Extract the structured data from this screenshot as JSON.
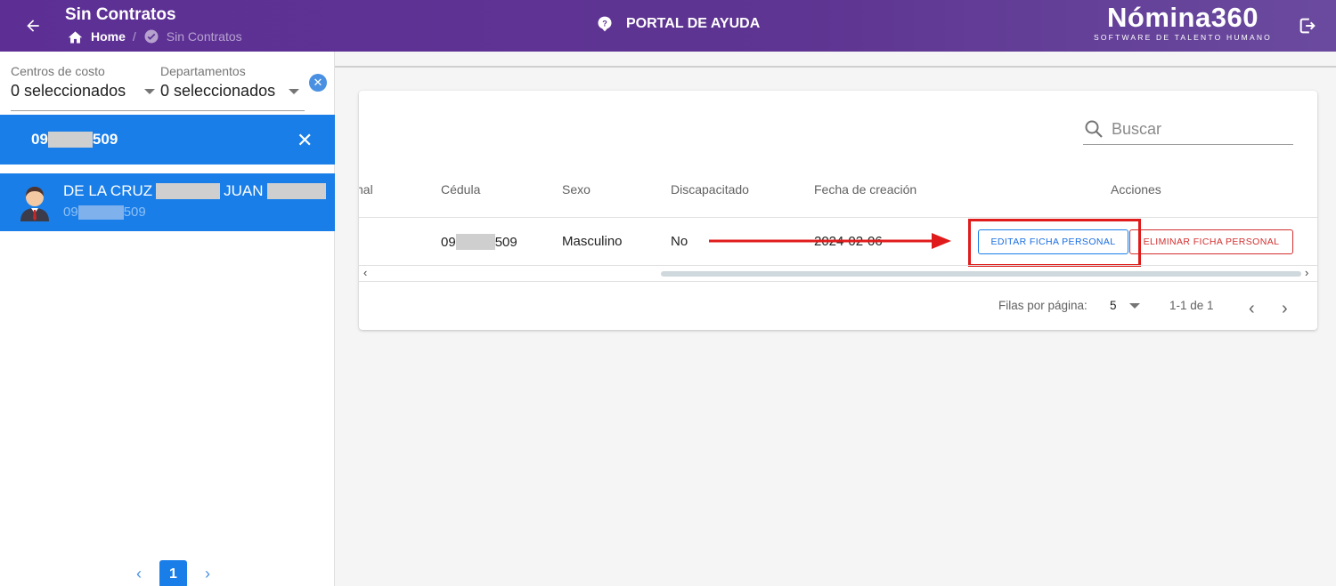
{
  "header": {
    "title": "Sin Contratos",
    "breadcrumb": {
      "home": "Home",
      "current": "Sin Contratos"
    },
    "help": "PORTAL DE AYUDA",
    "logo": {
      "brand": "Nómina360",
      "tagline": "SOFTWARE DE TALENTO HUMANO"
    }
  },
  "filters": {
    "cost_centers": {
      "label": "Centros de costo",
      "value": "0 seleccionados"
    },
    "departments": {
      "label": "Departamentos",
      "value": "0 seleccionados"
    }
  },
  "search_chip": {
    "prefix": "09",
    "suffix": "509"
  },
  "employee": {
    "name_first": "DE LA CRUZ",
    "name_middle": "JUAN",
    "id_prefix": "09",
    "id_suffix": "509"
  },
  "left_pager": {
    "page": "1"
  },
  "table": {
    "search_placeholder": "Buscar",
    "columns": [
      "nal",
      "Cédula",
      "Sexo",
      "Discapacitado",
      "Fecha de creación",
      "Acciones"
    ],
    "row": {
      "cedula_prefix": "09",
      "cedula_suffix": "509",
      "sexo": "Masculino",
      "discapacitado": "No",
      "fecha": "2024-02-06"
    },
    "actions": {
      "edit": "EDITAR FICHA PERSONAL",
      "delete": "ELIMINAR FICHA PERSONAL"
    }
  },
  "pagination": {
    "rows_label": "Filas por página:",
    "rows_value": "5",
    "range": "1-1 de 1"
  },
  "colors": {
    "header": "#5d2f95",
    "primary": "#1a7ee8",
    "danger": "#d32f2f",
    "annotation": "#e01b1b"
  }
}
